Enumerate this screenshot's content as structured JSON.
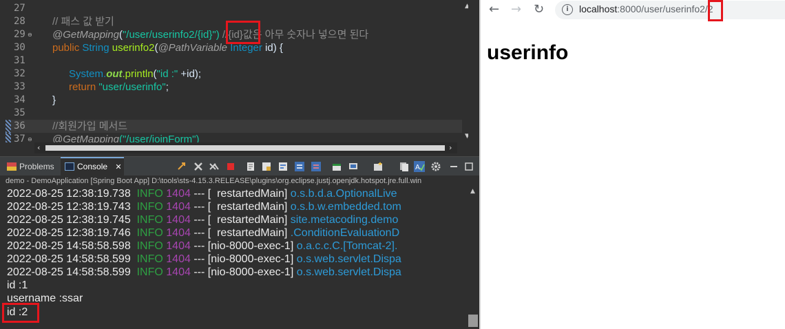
{
  "editor": {
    "line_numbers": [
      "27",
      "28",
      "29",
      "30",
      "31",
      "32",
      "33",
      "34",
      "35",
      "36",
      "37"
    ],
    "fold_marker": "⊖",
    "comment_pass_value": "// 패스 값 받기",
    "annotation": "@GetMapping",
    "mapping_prefix": "\"/user/userinfo2/",
    "mapping_var": "{id}",
    "mapping_suffix": "\")",
    "mapping_comment": " //{id}값은 아무 숫자나 넣으면 된다",
    "kw_public": "public",
    "type_string": "String",
    "method_name": "userinfo2",
    "paren_open": "(",
    "path_variable": "@PathVariable",
    "type_integer": "Integer",
    "param_tail": " id) {",
    "sys": "System.",
    "out": "out",
    "println": ".println",
    "println_open": "(",
    "println_str": "\"id :\"",
    "println_tail": " +id);",
    "kw_return": "return",
    "return_str": "\"user/userinfo\"",
    "return_tail": ";",
    "close_brace": "}",
    "comment_join": "//회원가입 메서드",
    "next_prefix": "(\"/user/joinForm\")"
  },
  "console": {
    "tabs": [
      {
        "label": "Problems"
      },
      {
        "label": "Console"
      }
    ],
    "close_glyph": "✕",
    "path_text": "demo - DemoApplication [Spring Boot App] D:\\tools\\sts-4.15.3.RELEASE\\plugins\\org.eclipse.justj.openjdk.hotspot.jre.full.win",
    "logs": [
      {
        "ts": "2022-08-25 12:38:19.738",
        "level": "INFO",
        "pid": "1404",
        "sep": " --- [",
        "thread": "  restartedMain]",
        "logger": " o.s.b.d.a.OptionalLive"
      },
      {
        "ts": "2022-08-25 12:38:19.743",
        "level": "INFO",
        "pid": "1404",
        "sep": " --- [",
        "thread": "  restartedMain]",
        "logger": " o.s.b.w.embedded.tom"
      },
      {
        "ts": "2022-08-25 12:38:19.745",
        "level": "INFO",
        "pid": "1404",
        "sep": " --- [",
        "thread": "  restartedMain]",
        "logger": " site.metacoding.demo"
      },
      {
        "ts": "2022-08-25 12:38:19.746",
        "level": "INFO",
        "pid": "1404",
        "sep": " --- [",
        "thread": "  restartedMain]",
        "logger": " .ConditionEvaluationD"
      },
      {
        "ts": "2022-08-25 14:58:58.598",
        "level": "INFO",
        "pid": "1404",
        "sep": " --- [",
        "thread": "nio-8000-exec-1]",
        "logger": " o.a.c.c.C.[Tomcat-2]."
      },
      {
        "ts": "2022-08-25 14:58:58.599",
        "level": "INFO",
        "pid": "1404",
        "sep": " --- [",
        "thread": "nio-8000-exec-1]",
        "logger": " o.s.web.servlet.Dispa"
      },
      {
        "ts": "2022-08-25 14:58:58.599",
        "level": "INFO",
        "pid": "1404",
        "sep": " --- [",
        "thread": "nio-8000-exec-1]",
        "logger": " o.s.web.servlet.Dispa"
      }
    ],
    "output": [
      "id :1",
      "username :ssar",
      "id :2"
    ]
  },
  "browser": {
    "back": "←",
    "forward": "→",
    "reload": "↻",
    "info_glyph": "i",
    "url_host": "localhost",
    "url_path": ":8000/user/userinfo2/",
    "url_id": "2",
    "heading": "userinfo"
  },
  "colors": {
    "highlight_box": "#e5161d",
    "console_level": "#2ea043",
    "console_pid": "#a745b0",
    "console_logger": "#2d9bd8"
  }
}
